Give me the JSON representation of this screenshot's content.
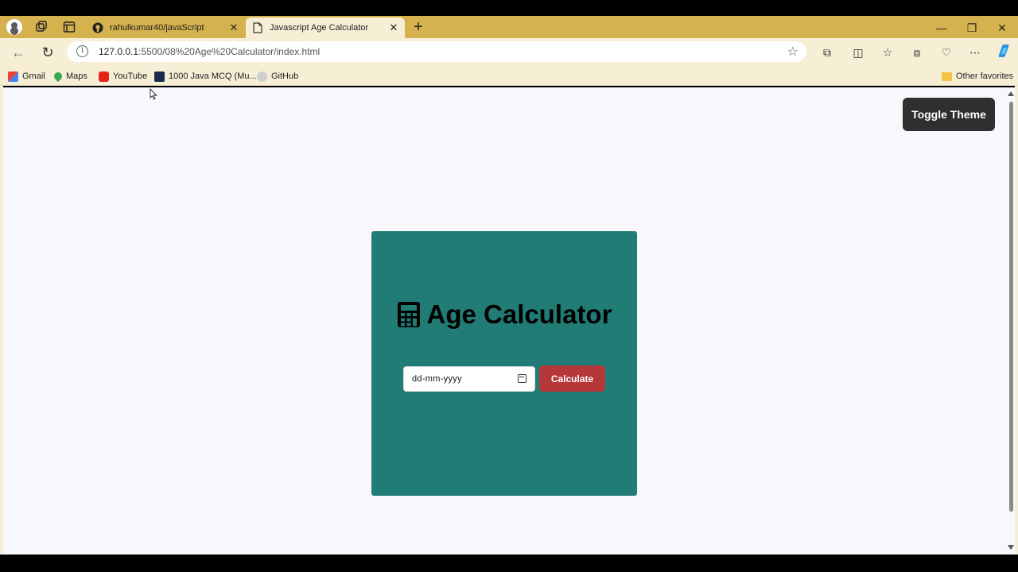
{
  "browser": {
    "tabs": [
      {
        "title": "rahulkumar40/javaScript",
        "active": false
      },
      {
        "title": "Javascript Age Calculator",
        "active": true
      }
    ],
    "url_host": "127.0.0.1",
    "url_path": ":5500/08%20Age%20Calculator/index.html",
    "bookmarks": [
      {
        "label": "Gmail"
      },
      {
        "label": "Maps"
      },
      {
        "label": "YouTube"
      },
      {
        "label": "1000 Java MCQ (Mu..."
      },
      {
        "label": "GitHub"
      }
    ],
    "other_favorites": "Other favorites"
  },
  "page": {
    "toggle_theme_label": "Toggle Theme",
    "heading": "Age Calculator",
    "date_placeholder": "dd-mm-yyyy",
    "calculate_label": "Calculate"
  },
  "colors": {
    "tabstrip": "#d6b24e",
    "card": "#217c75",
    "calculate_button": "#b5373a",
    "toggle_button": "#2f2f2f",
    "page_background": "#f7f7fc"
  }
}
